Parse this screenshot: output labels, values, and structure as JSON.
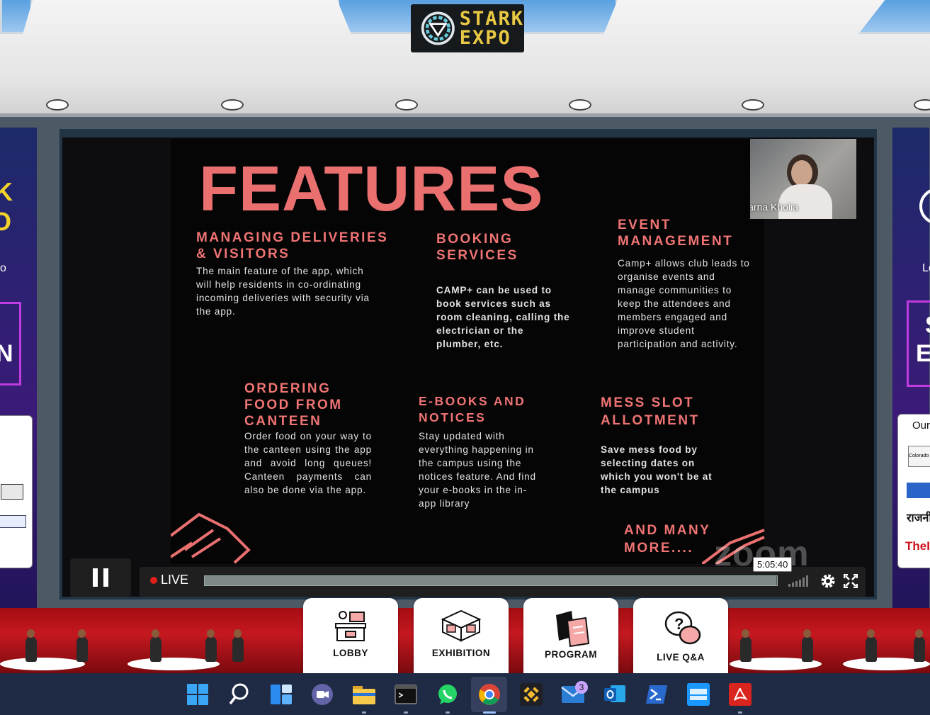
{
  "event_logo": {
    "line1": "STARK",
    "line2": "EXPO"
  },
  "slide": {
    "title": "FEATURES",
    "features": [
      {
        "heading": "MANAGING DELIVERIES\n& VISITORS",
        "body": "The main feature of the app, which will help residents in co-ordinating incoming deliveries with security via the app."
      },
      {
        "heading": "BOOKING\nSERVICES",
        "body": "CAMP+ can be used to book services such as room cleaning, calling the electrician or the plumber, etc."
      },
      {
        "heading": "EVENT\nMANAGEMENT",
        "body": "Camp+ allows club leads to organise events and manage communities to keep the attendees and members engaged and improve student participation and activity."
      },
      {
        "heading": "ORDERING\nFOOD  FROM\nCANTEEN",
        "body": "Order food on your way to the canteen using the app and avoid long queues! Canteen payments can also be done via the app."
      },
      {
        "heading": "E-BOOKS AND\nNOTICES",
        "body": "Stay updated with everything happening in the campus using the notices feature. And find your e-books in the in-app library"
      },
      {
        "heading": "MESS SLOT\nALLOTMENT",
        "body": "Save mess food by selecting dates on which you won't be at the campus"
      }
    ],
    "closing": "AND MANY\nMORE...."
  },
  "presenter": {
    "name": "Aparna Kholia"
  },
  "watermark": "zoom",
  "player": {
    "live_label": "LIVE",
    "time_tooltip": "5:05:40",
    "progress": 0.999
  },
  "left_panel": {
    "letters": [
      "K",
      "O"
    ],
    "big_letter": "N",
    "small_text": "o"
  },
  "right_panel": {
    "letters": [
      "S",
      "E"
    ],
    "small_text": "Lo",
    "our_label": "Our",
    "sponsor_labels": [
      "Colorado",
      "",
      "राजनी",
      "TheI"
    ]
  },
  "nav": [
    {
      "id": "lobby",
      "label": "LOBBY"
    },
    {
      "id": "exhibition",
      "label": "EXHIBITION"
    },
    {
      "id": "program",
      "label": "PROGRAM"
    },
    {
      "id": "live_qa",
      "label": "LIVE Q&A"
    }
  ],
  "taskbar": {
    "apps": [
      "windows-start",
      "search",
      "widgets",
      "teams",
      "file-explorer",
      "terminal",
      "whatsapp",
      "chrome",
      "binance",
      "mail",
      "outlook",
      "powershell",
      "prime-video",
      "acrobat"
    ],
    "active_app": "chrome",
    "mail_badge": "3",
    "colors": {
      "taskbar": "#1f2a44",
      "accent": "#9fc2ff"
    }
  }
}
